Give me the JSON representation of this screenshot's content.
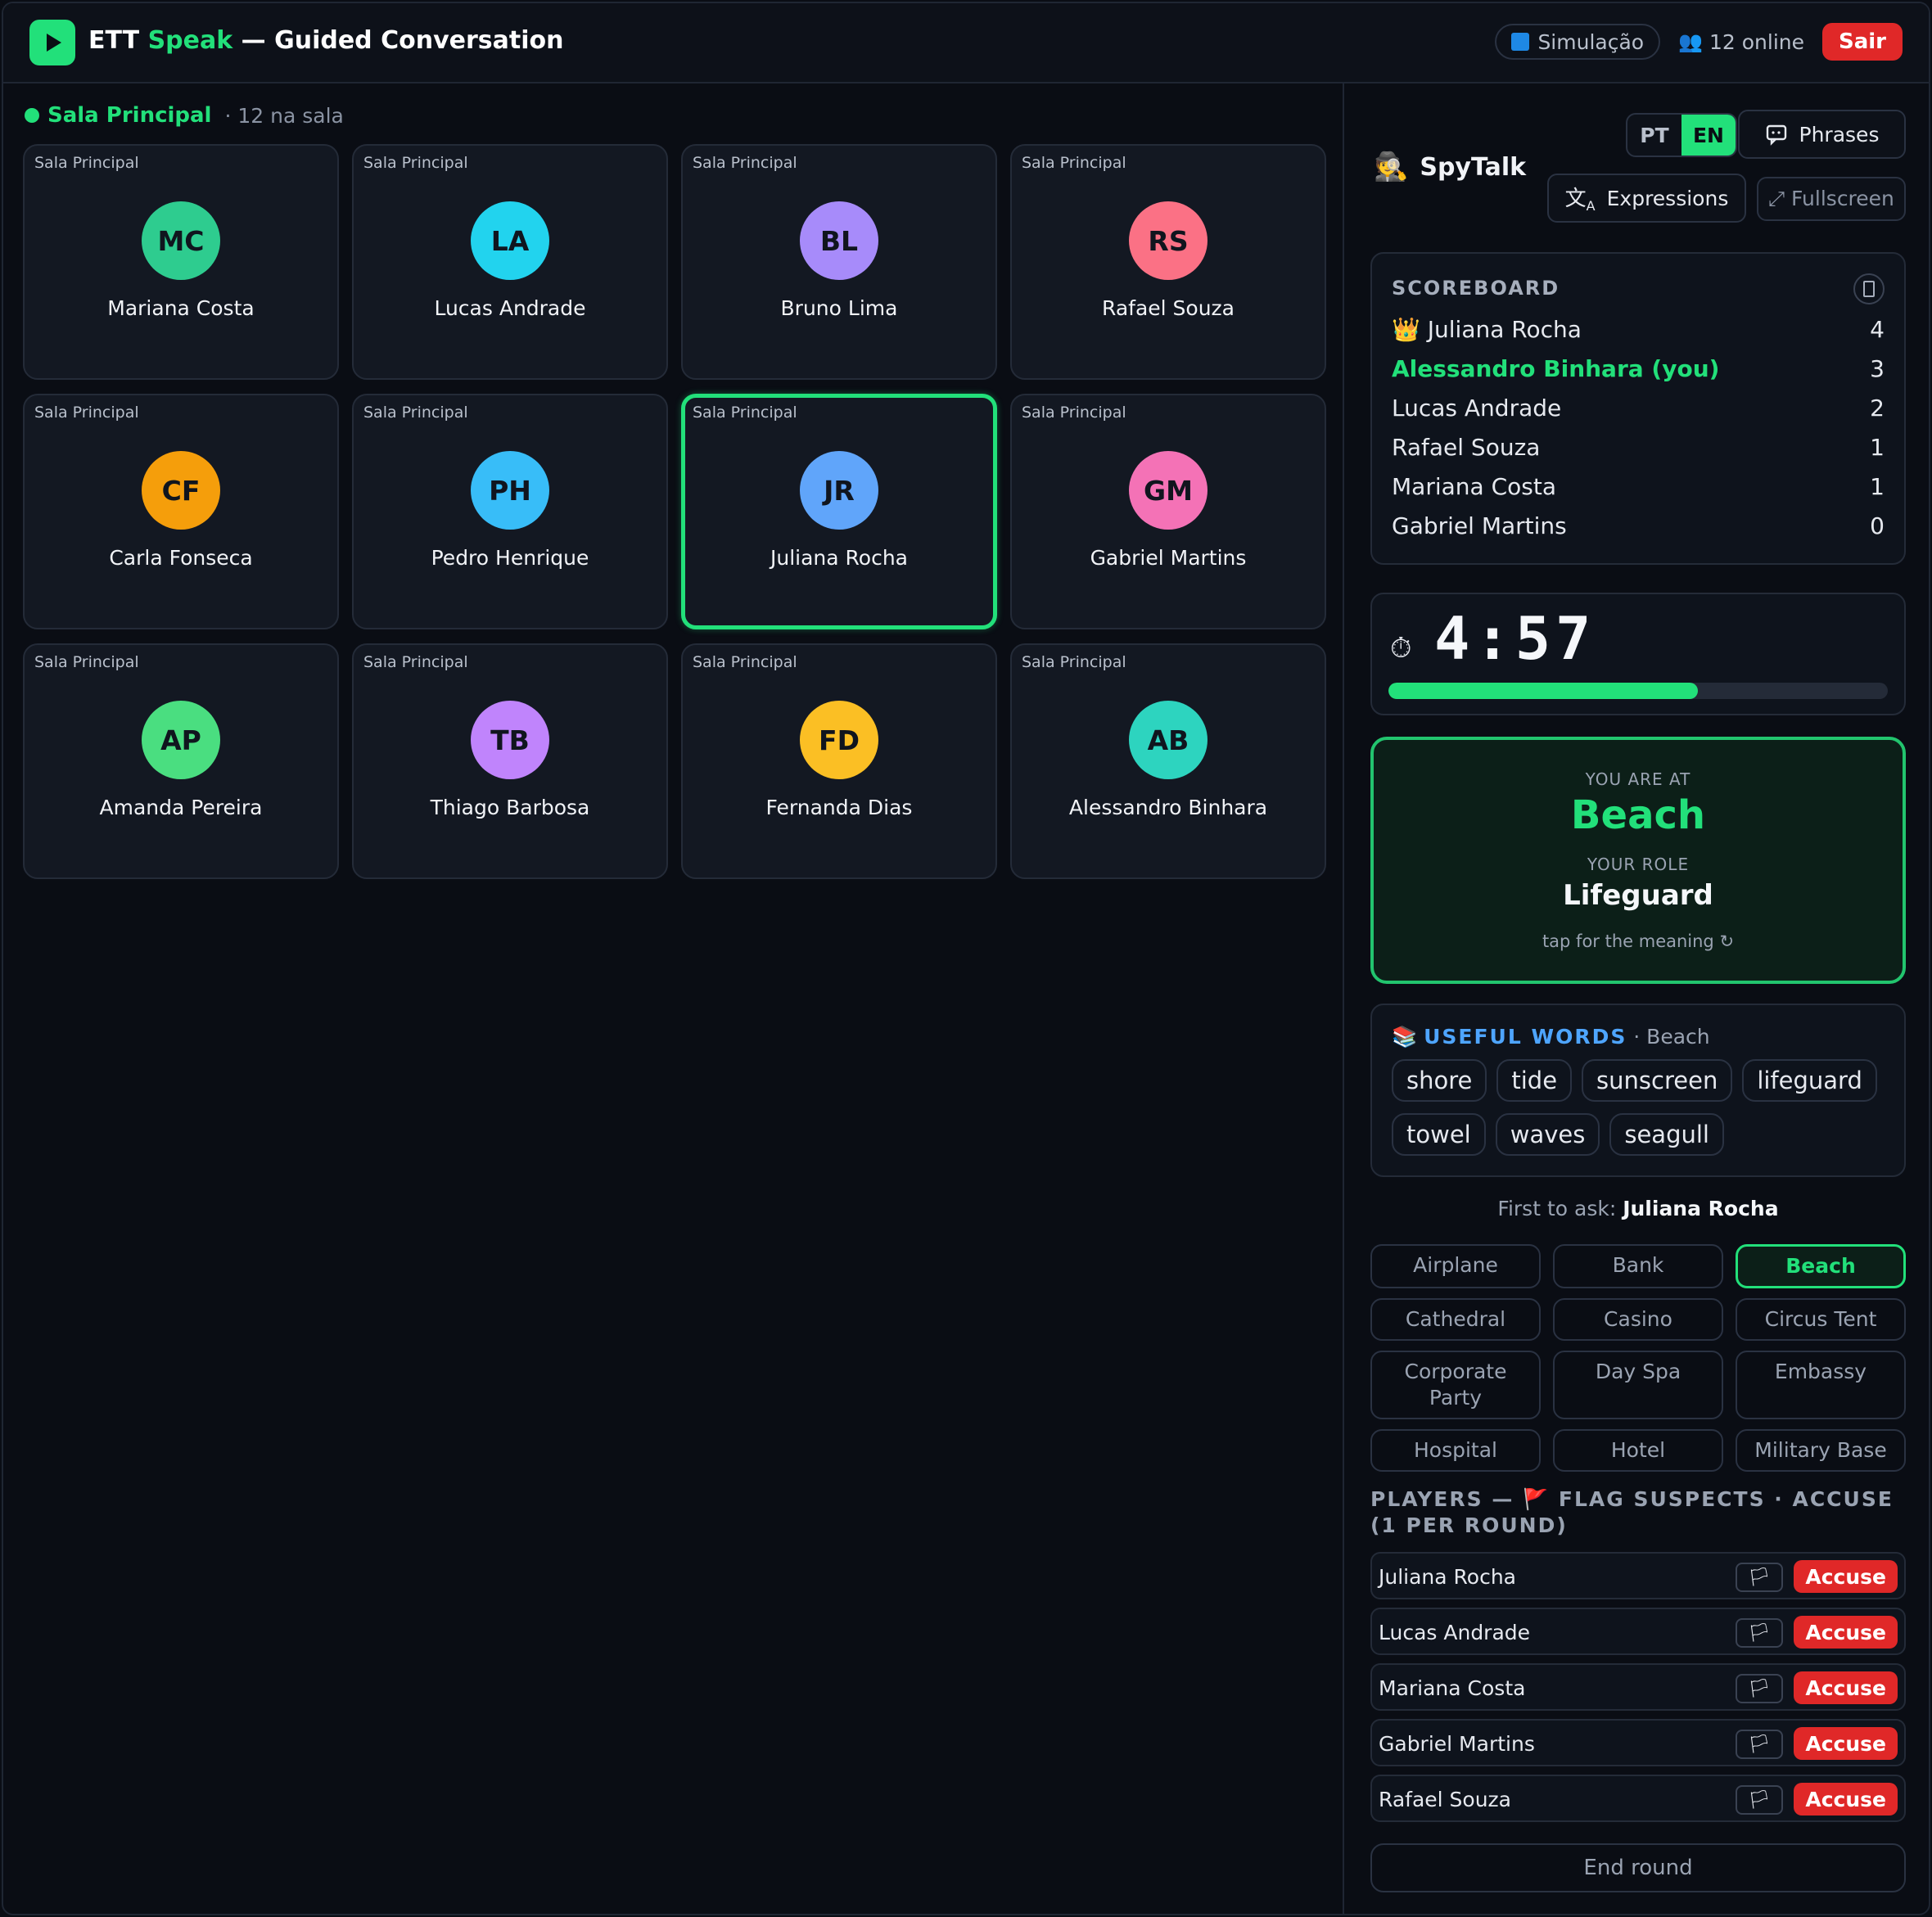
{
  "header": {
    "brand_part1": "ETT",
    "brand_part2": "Speak",
    "brand_part3": "— Guided Conversation",
    "sim_label": "Simulação",
    "online_label": "12 online",
    "sair_label": "Sair"
  },
  "room": {
    "name": "Sala Principal",
    "count": "· 12 na sala"
  },
  "tiles": [
    {
      "room": "Sala Principal",
      "initials": "MC",
      "name": "Mariana Costa",
      "color": "#2ecc8f"
    },
    {
      "room": "Sala Principal",
      "initials": "LA",
      "name": "Lucas Andrade",
      "color": "#22d3ee"
    },
    {
      "room": "Sala Principal",
      "initials": "BL",
      "name": "Bruno Lima",
      "color": "#a78bfa"
    },
    {
      "room": "Sala Principal",
      "initials": "RS",
      "name": "Rafael Souza",
      "color": "#fb7185"
    },
    {
      "room": "Sala Principal",
      "initials": "CF",
      "name": "Carla Fonseca",
      "color": "#f59e0b"
    },
    {
      "room": "Sala Principal",
      "initials": "PH",
      "name": "Pedro Henrique",
      "color": "#38bdf8"
    },
    {
      "room": "Sala Principal",
      "initials": "JR",
      "name": "Juliana Rocha",
      "color": "#60a5fa"
    },
    {
      "room": "Sala Principal",
      "initials": "GM",
      "name": "Gabriel Martins",
      "color": "#f472b6"
    },
    {
      "room": "Sala Principal",
      "initials": "AP",
      "name": "Amanda Pereira",
      "color": "#4ade80"
    },
    {
      "room": "Sala Principal",
      "initials": "TB",
      "name": "Thiago Barbosa",
      "color": "#c084fc"
    },
    {
      "room": "Sala Principal",
      "initials": "FD",
      "name": "Fernanda Dias",
      "color": "#fbbf24"
    },
    {
      "room": "Sala Principal",
      "initials": "AB",
      "name": "Alessandro Binhara",
      "color": "#2dd4bf"
    }
  ],
  "panel": {
    "app_name": "SpyTalk",
    "lang_pt": "PT",
    "lang_en": "EN",
    "phrases_label": "Phrases",
    "expressions_label": "Expressions",
    "fullscreen_label": "⤢ Fullscreen"
  },
  "scoreboard": {
    "title": "SCOREBOARD",
    "rows": [
      {
        "name": "👑 Juliana Rocha",
        "score": "4"
      },
      {
        "name": "Alessandro Binhara (you)",
        "score": "3"
      },
      {
        "name": "Lucas Andrade",
        "score": "2"
      },
      {
        "name": "Rafael Souza",
        "score": "1"
      },
      {
        "name": "Mariana Costa",
        "score": "1"
      },
      {
        "name": "Gabriel Martins",
        "score": "0"
      }
    ]
  },
  "timer": {
    "value": "4:57",
    "progress_fraction": 0.62
  },
  "location_card": {
    "at_label": "YOU ARE AT",
    "location": "Beach",
    "role_label": "YOUR ROLE",
    "role": "Lifeguard",
    "hint": "tap for the meaning ↻"
  },
  "useful_words": {
    "title": "USEFUL WORDS",
    "subtitle": "· Beach",
    "words": [
      "shore",
      "tide",
      "sunscreen",
      "lifeguard",
      "towel",
      "waves",
      "seagull"
    ]
  },
  "first_to_ask": {
    "label": "First to ask:",
    "name": "Juliana Rocha"
  },
  "locations": [
    "Airplane",
    "Bank",
    "Beach",
    "Cathedral",
    "Casino",
    "Circus Tent",
    "Corporate Party",
    "Day Spa",
    "Embassy",
    "Hospital",
    "Hotel",
    "Military Base"
  ],
  "selected_location": "Beach",
  "players": {
    "title": "PLAYERS — 🚩 FLAG SUSPECTS · ACCUSE (1 PER ROUND)",
    "flag_symbol": "🏳",
    "accuse_label": "Accuse",
    "list": [
      "Juliana Rocha",
      "Lucas Andrade",
      "Mariana Costa",
      "Gabriel Martins",
      "Rafael Souza"
    ]
  },
  "end_round_label": "End round",
  "colors": {
    "accent": "#22e07a",
    "danger": "#e02828",
    "info": "#4ea5ff",
    "background": "#0a0d14"
  }
}
